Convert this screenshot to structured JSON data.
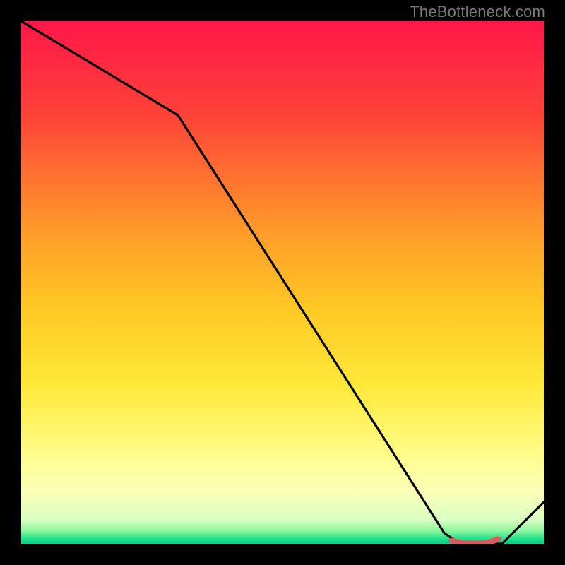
{
  "attribution": "TheBottleneck.com",
  "chart_data": {
    "type": "line",
    "title": "",
    "xlabel": "",
    "ylabel": "",
    "xlim": [
      0,
      100
    ],
    "ylim": [
      0,
      100
    ],
    "series": [
      {
        "name": "bottleneck-curve",
        "x": [
          0,
          30,
          81,
          84,
          92,
          100
        ],
        "values": [
          100,
          82,
          2,
          0,
          0,
          8
        ]
      }
    ],
    "markers": {
      "name": "optimal-region",
      "x": [
        82.5,
        83.2,
        84.0,
        85.0,
        86.0,
        86.8,
        87.5,
        88.2,
        89.0,
        89.5,
        90.0,
        90.5,
        91.2
      ],
      "values": [
        0.6,
        0.4,
        0.25,
        0.15,
        0.1,
        0.1,
        0.1,
        0.15,
        0.2,
        0.3,
        0.4,
        0.6,
        0.9
      ]
    },
    "gradient": {
      "stops": [
        {
          "offset": 0,
          "color": "#ff1749"
        },
        {
          "offset": 0.18,
          "color": "#ff4238"
        },
        {
          "offset": 0.4,
          "color": "#ff9a2a"
        },
        {
          "offset": 0.55,
          "color": "#ffc824"
        },
        {
          "offset": 0.7,
          "color": "#ffe93a"
        },
        {
          "offset": 0.82,
          "color": "#fffb84"
        },
        {
          "offset": 0.9,
          "color": "#fbffb8"
        },
        {
          "offset": 0.955,
          "color": "#d8ffc2"
        },
        {
          "offset": 0.975,
          "color": "#8df5a0"
        },
        {
          "offset": 0.99,
          "color": "#26e08a"
        },
        {
          "offset": 1.0,
          "color": "#00d184"
        }
      ]
    }
  }
}
